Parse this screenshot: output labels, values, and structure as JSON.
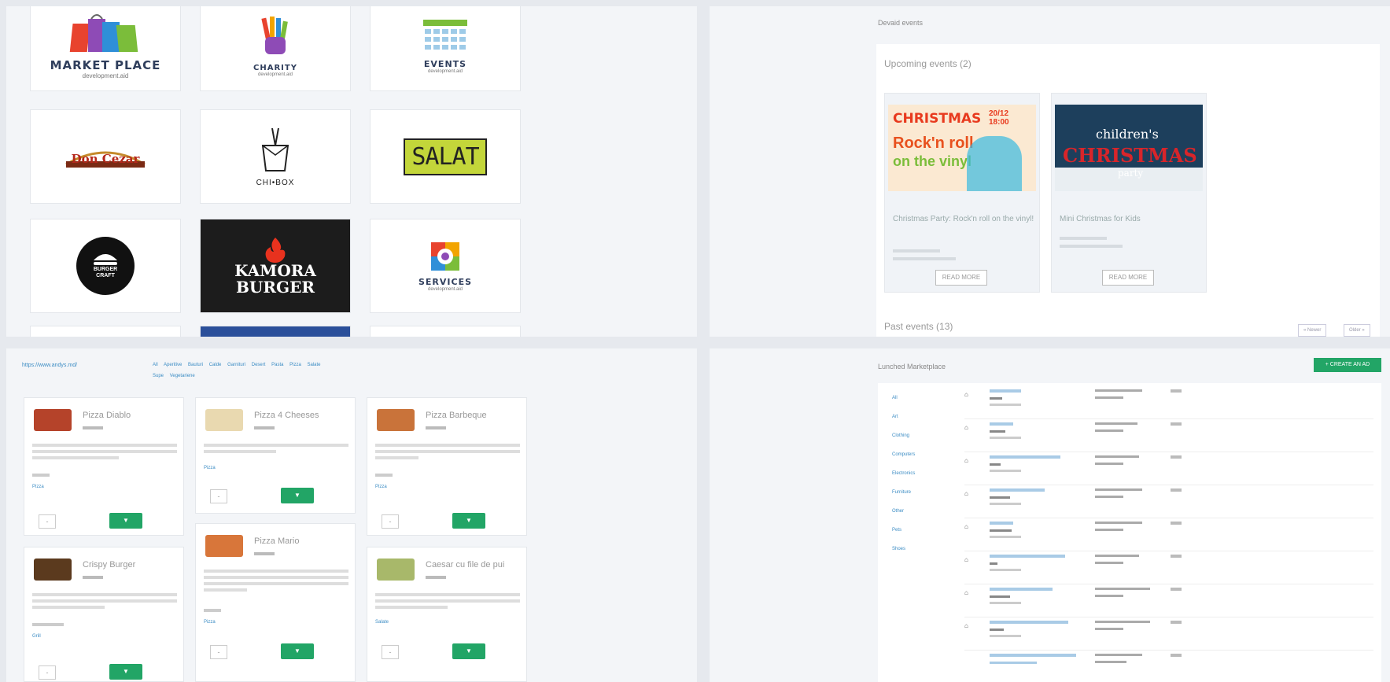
{
  "logos": {
    "marketplace": {
      "title": "MARKET PLACE",
      "sub": "development.aid"
    },
    "charity": {
      "title": "CHARITY",
      "sub": "development.aid"
    },
    "events": {
      "title": "EVENTS",
      "sub": "development.aid"
    },
    "doncezar": {
      "title": "Don Cezar"
    },
    "chibox": {
      "title": "CHI•BOX"
    },
    "salat": {
      "title": "SALAT"
    },
    "burgercraft": {
      "title": "BURGER CRAFT"
    },
    "kamora": {
      "line1": "KAMORA",
      "line2": "BURGER"
    },
    "services": {
      "title": "SERVICES",
      "sub": "development.aid"
    }
  },
  "events": {
    "breadcrumb": "Devaid events",
    "upcoming_title": "Upcoming events (2)",
    "past_title": "Past events (13)",
    "cards": [
      {
        "title": "Christmas Party: Rock'n roll on the vinyl!",
        "banner1": "CHRISTMAS",
        "banner2": "Rock'n roll",
        "banner3": "on the vinyl",
        "date_badge": "20/12 18:00",
        "read_more": "READ MORE"
      },
      {
        "title": "Mini Christmas for Kids",
        "banner1": "children's",
        "banner2": "CHRISTMAS",
        "banner3": "party",
        "read_more": "READ MORE"
      }
    ],
    "pager": {
      "newer": "« Newer",
      "older": "Older »"
    }
  },
  "menu": {
    "url": "https://www.andys.md/",
    "tags": [
      "All",
      "Aperitive",
      "Bauturi",
      "Calde",
      "Garnituri",
      "Desert",
      "Pasta",
      "Pizza",
      "Salate",
      "Supe",
      "Vegetariene"
    ],
    "items": [
      {
        "title": "Pizza Diablo",
        "tag": "Pizza"
      },
      {
        "title": "Pizza 4 Cheeses",
        "tag": "Pizza"
      },
      {
        "title": "Pizza Barbeque",
        "tag": "Pizza"
      },
      {
        "title": "Crispy Burger",
        "tag": "Grill"
      },
      {
        "title": "Pizza Mario",
        "tag": "Pizza"
      },
      {
        "title": "Caesar cu file de pui",
        "tag": "Salate"
      }
    ],
    "qty_label": "-",
    "cart_icon": "cart-icon"
  },
  "marketplace": {
    "title": "Lunched Marketplace",
    "create_label": "+ CREATE AN AD",
    "categories": [
      "All",
      "Art",
      "Clothing",
      "Computers",
      "Electronics",
      "Furniture",
      "Other",
      "Pets",
      "Shoes"
    ]
  }
}
